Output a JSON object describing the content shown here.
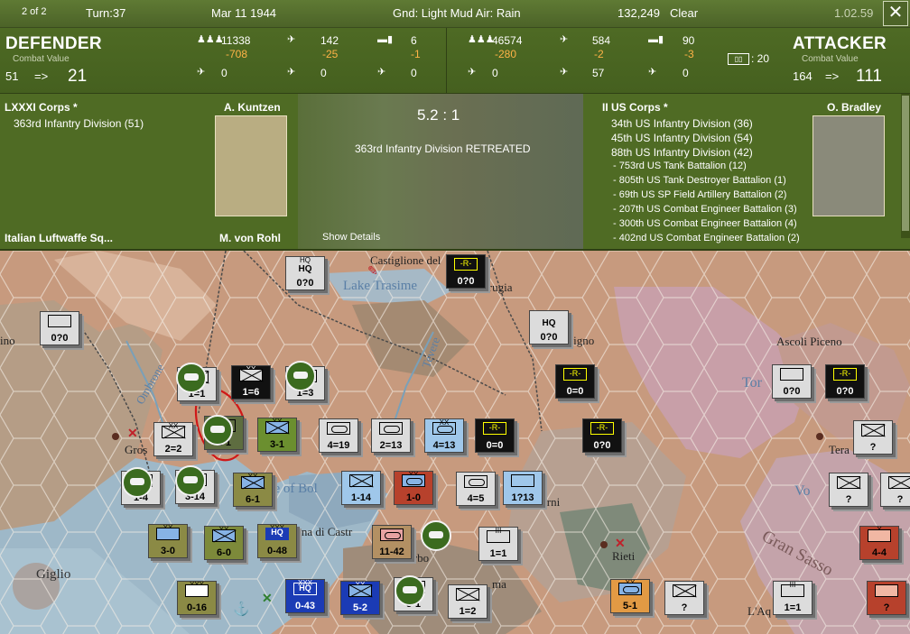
{
  "topbar": {
    "page": "2 of 2",
    "turn": "Turn:37",
    "date": "Mar 11 1944",
    "weather": "Gnd: Light Mud   Air: Rain",
    "pp": "132,249",
    "sky": "Clear",
    "version": "1.02.59",
    "close_label": "✕"
  },
  "defender": {
    "title": "DEFENDER",
    "cv_label": "Combat Value",
    "cv_from": "51",
    "arrow": "=>",
    "cv_to": "21",
    "men": "11338",
    "men_loss": "-708",
    "air": "142",
    "air_loss": "-25",
    "tanks": "6",
    "tanks_loss": "-1",
    "r2a": "0",
    "r2b": "0",
    "r2c": "0"
  },
  "attacker": {
    "title": "ATTACKER",
    "cv_label": "Combat Value",
    "cv_from": "164",
    "arrow": "=>",
    "cv_to": "111",
    "men": "46574",
    "men_loss": "-280",
    "air": "584",
    "air_loss": "-2",
    "tanks": "90",
    "tanks_loss": "-3",
    "r2a": "0",
    "r2b": "57",
    "r2c": "0",
    "ratio_badge": ": 20"
  },
  "left_panel": {
    "corps": "LXXXI Corps *",
    "commander": "A. Kuntzen",
    "units": [
      "363rd Infantry Division (51)"
    ],
    "cut_line_a": "Italian Luftwaffe Sq...",
    "cut_line_b": "M. von Rohl"
  },
  "center_panel": {
    "odds": "5.2 : 1",
    "result": "363rd Infantry Division RETREATED",
    "show_details": "Show Details"
  },
  "right_panel": {
    "corps": "II US Corps *",
    "commander": "O. Bradley",
    "divisions": [
      "34th US Infantry Division (36)",
      "45th US Infantry Division (54)",
      "88th US Infantry Division (42)"
    ],
    "attachments": [
      "- 753rd US Tank Battalion (12)",
      "- 805th US Tank Destroyer Battalion (1)",
      "- 69th US SP Field Artillery Battalion (2)",
      "- 207th US Combat Engineer Battalion (3)",
      "- 300th US Combat Engineer Battalion (4)",
      "- 402nd US Combat Engineer Battalion (2)"
    ]
  },
  "map": {
    "labels": {
      "castiglione": "Castiglione del",
      "lake_trasimeno": "Lake Trasime",
      "perugia": "erugia",
      "ino": "ino",
      "oligno": "oligno",
      "ascoli": "Ascoli Piceno",
      "tevere": "Tevere",
      "ombrone": "Ombrone",
      "tor": "Tor",
      "tera": "Tera",
      "gros": "Gros",
      "lake_bolsena": "ke of Bol",
      "erni": "erni",
      "vo": "Vo",
      "castr": "olena di Castr",
      "rieti": "Rieti",
      "gran_sasso": "Gran Sasso",
      "giglio": "Giglio",
      "erbo": "erbo",
      "ma": "ma",
      "la": "L'Aq"
    },
    "counters": {
      "hq1": {
        "size": "HQ",
        "str": "0?0"
      },
      "box1": {
        "size": "",
        "str": "0?0"
      },
      "r1": {
        "size": "",
        "str": "0?0"
      },
      "hq2": {
        "size": "HQ",
        "str": "0?0"
      },
      "r2": {
        "size": "",
        "str": "0=0"
      },
      "tor_box": {
        "size": "",
        "str": "0?0"
      },
      "r3": {
        "size": "",
        "str": "0?0"
      },
      "u1": {
        "size": "",
        "str": "1=1"
      },
      "u2": {
        "size": "XX",
        "str": "1=6"
      },
      "u3": {
        "size": "",
        "str": "1=3"
      },
      "u4": {
        "size": "XX",
        "str": "2=2"
      },
      "u5": {
        "size": "",
        "str": "2-1"
      },
      "u6": {
        "size": "XX",
        "str": "3-1"
      },
      "u7": {
        "size": "",
        "str": "4=19"
      },
      "u8": {
        "size": "",
        "str": "2=13"
      },
      "u9": {
        "size": "XX",
        "str": "4=13"
      },
      "u10": {
        "size": "",
        "str": "0=0"
      },
      "u11": {
        "size": "",
        "str": "0?0"
      },
      "u12": {
        "size": "",
        "str": "?"
      },
      "u13": {
        "size": "",
        "str": "1-4"
      },
      "u14": {
        "size": "",
        "str": "3-14"
      },
      "u15": {
        "size": "XX",
        "str": "6-1"
      },
      "u16": {
        "size": "",
        "str": "1-14"
      },
      "u17": {
        "size": "XX",
        "str": "1-0"
      },
      "u18": {
        "size": "",
        "str": "4=5"
      },
      "u19": {
        "size": "",
        "str": "1?13"
      },
      "u20": {
        "size": "",
        "str": "?"
      },
      "u21": {
        "size": "",
        "str": "?"
      },
      "u22": {
        "size": "XX",
        "str": "3-0"
      },
      "u23": {
        "size": "XX",
        "str": "6-0"
      },
      "u24": {
        "size": "XXX",
        "str": "0-48"
      },
      "u25": {
        "size": "",
        "str": "11-42"
      },
      "u26": {
        "size": "III",
        "str": "1=1"
      },
      "u27": {
        "size": "X",
        "str": "4-4"
      },
      "u28": {
        "size": "XXX",
        "str": "0-16"
      },
      "u29": {
        "size": "XXX",
        "str": "0-43"
      },
      "u30": {
        "size": "XX",
        "str": "5-2"
      },
      "u31": {
        "size": "",
        "str": "5-1"
      },
      "u32": {
        "size": "",
        "str": "1=2"
      },
      "u33": {
        "size": "XX",
        "str": "5-1"
      },
      "u34": {
        "size": "",
        "str": "?"
      },
      "u35": {
        "size": "III",
        "str": "1=1"
      },
      "u36": {
        "size": "",
        "str": "?"
      }
    }
  },
  "colors": {
    "header_green": "#556b2f",
    "loss_orange": "#ffb347",
    "selection_red": "#d01818"
  }
}
